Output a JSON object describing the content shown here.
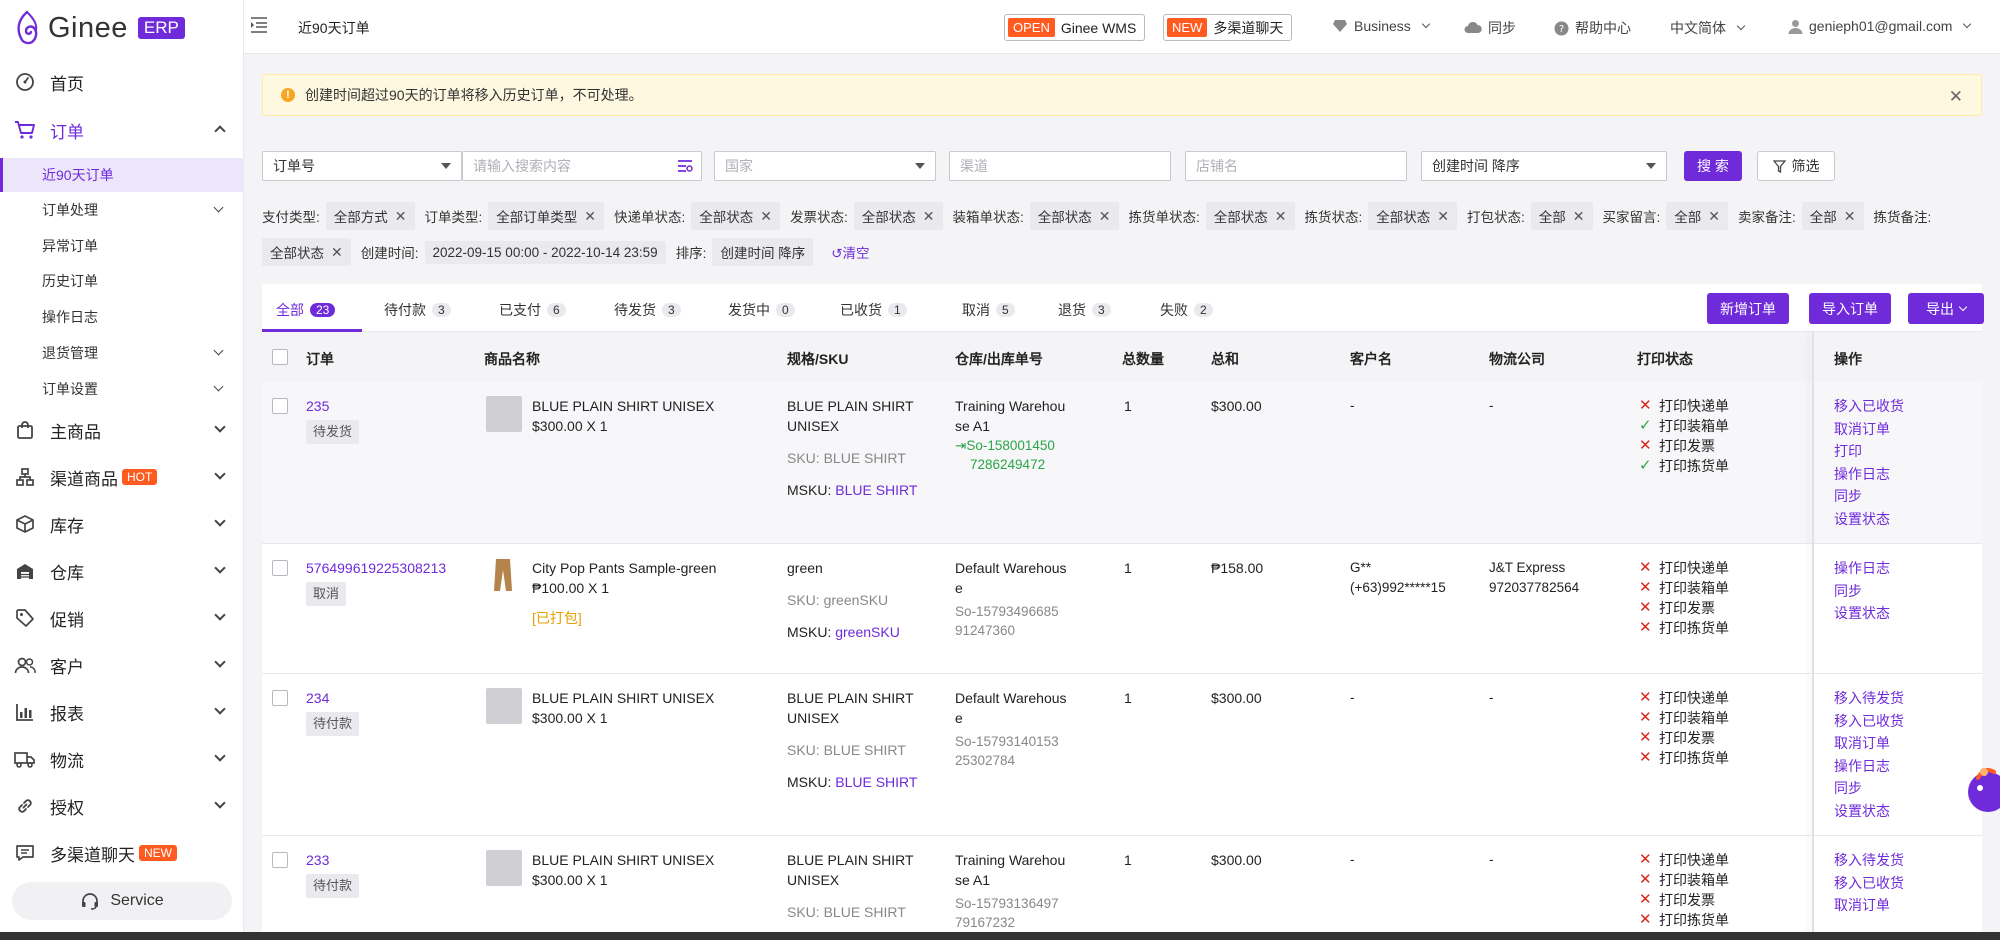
{
  "logo": {
    "name": "Ginee",
    "badge": "ERP"
  },
  "sidebar": {
    "items": [
      {
        "label": "首页",
        "icon": "dashboard-icon"
      },
      {
        "label": "订单",
        "icon": "cart-icon"
      },
      {
        "label": "主商品",
        "icon": "bag-icon"
      },
      {
        "label": "渠道商品",
        "icon": "channel-icon",
        "badge": "HOT"
      },
      {
        "label": "库存",
        "icon": "box-icon"
      },
      {
        "label": "仓库",
        "icon": "warehouse-icon"
      },
      {
        "label": "促销",
        "icon": "tag-icon"
      },
      {
        "label": "客户",
        "icon": "users-icon"
      },
      {
        "label": "报表",
        "icon": "chart-icon"
      },
      {
        "label": "物流",
        "icon": "truck-icon"
      },
      {
        "label": "授权",
        "icon": "link-icon"
      },
      {
        "label": "多渠道聊天",
        "icon": "chat-icon",
        "badge": "NEW"
      }
    ],
    "order_sub": [
      "近90天订单",
      "订单处理",
      "异常订单",
      "历史订单",
      "操作日志",
      "退货管理",
      "订单设置"
    ],
    "service": "Service"
  },
  "header": {
    "title": "近90天订单",
    "wms_tag": "OPEN",
    "wms_label": "Ginee WMS",
    "chat_tag": "NEW",
    "chat_label": "多渠道聊天",
    "business": "Business",
    "sync": "同步",
    "help": "帮助中心",
    "lang": "中文简体",
    "user": "genieph01@gmail.com"
  },
  "alert": {
    "text": "创建时间超过90天的订单将移入历史订单，不可处理。"
  },
  "filters": {
    "field": "订单号",
    "search_placeholder": "请输入搜索内容",
    "country_placeholder": "国家",
    "channel_placeholder": "渠道",
    "store_placeholder": "店铺名",
    "sort": "创建时间 降序",
    "search_btn": "搜 索",
    "filter_btn": "筛选"
  },
  "chips_row1": [
    {
      "label": "支付类型:",
      "value": "全部方式"
    },
    {
      "label": "订单类型:",
      "value": "全部订单类型"
    },
    {
      "label": "快递单状态:",
      "value": "全部状态"
    },
    {
      "label": "发票状态:",
      "value": "全部状态"
    },
    {
      "label": "装箱单状态:",
      "value": "全部状态"
    },
    {
      "label": "拣货单状态:",
      "value": "全部状态"
    },
    {
      "label": "拣货状态:",
      "value": "全部状态"
    },
    {
      "label": "打包状态:",
      "value": "全部"
    },
    {
      "label": "买家留言:",
      "value": "全部"
    },
    {
      "label": "卖家备注:",
      "value": "全部"
    }
  ],
  "chips_row1_tail": "拣货备注:",
  "chips_row2": {
    "first_value": "全部状态",
    "created_label": "创建时间:",
    "created_value": "2022-09-15 00:00 - 2022-10-14 23:59",
    "sort_label": "排序:",
    "sort_value": "创建时间 降序",
    "clear": "清空"
  },
  "tabs": [
    {
      "label": "全部",
      "count": "23"
    },
    {
      "label": "待付款",
      "count": "3"
    },
    {
      "label": "已支付",
      "count": "6"
    },
    {
      "label": "待发货",
      "count": "3"
    },
    {
      "label": "发货中",
      "count": "0"
    },
    {
      "label": "已收货",
      "count": "1"
    },
    {
      "label": "取消",
      "count": "5"
    },
    {
      "label": "退货",
      "count": "3"
    },
    {
      "label": "失败",
      "count": "2"
    }
  ],
  "actions": {
    "new_order": "新增订单",
    "import": "导入订单",
    "export": "导出"
  },
  "columns": [
    "订单",
    "商品名称",
    "规格/SKU",
    "仓库/出库单号",
    "总数量",
    "总和",
    "客户名",
    "物流公司",
    "打印状态",
    "操作"
  ],
  "print_labels": [
    "打印快递单",
    "打印装箱单",
    "打印发票",
    "打印拣货单"
  ],
  "rows": [
    {
      "order": "235",
      "status": "待发货",
      "product": "BLUE PLAIN SHIRT UNISEX",
      "price": "$300.00 X 1",
      "packed": "",
      "spec1": "BLUE PLAIN SHIRT",
      "spec2": "UNISEX",
      "sku_label": "SKU:",
      "sku": "BLUE SHIRT",
      "msku_label": "MSKU:",
      "msku": "BLUE SHIRT",
      "wh1": "Training Warehou",
      "wh2": "se A1",
      "out1": "So-158001450",
      "out2": "7286249472",
      "qty": "1",
      "total": "$300.00",
      "customer": "-",
      "customer2": "",
      "logistics": "-",
      "logistics2": "",
      "print": [
        "x",
        "ok",
        "x",
        "ok"
      ],
      "ops": [
        "移入已收货",
        "取消订单",
        "打印",
        "操作日志",
        "同步",
        "设置状态"
      ]
    },
    {
      "order": "576499619225308213",
      "status": "取消",
      "product": "City Pop Pants Sample-green",
      "price": "₱100.00 X 1",
      "packed": "[已打包]",
      "spec1": "green",
      "spec2": "",
      "sku_label": "SKU:",
      "sku": "greenSKU",
      "msku_label": "MSKU:",
      "msku": "greenSKU",
      "wh1": "Default Warehous",
      "wh2": "e",
      "out1": "So-15793496685",
      "out2": "91247360",
      "qty": "1",
      "total": "₱158.00",
      "customer": "G**",
      "customer2": "(+63)992*****15",
      "logistics": "J&T Express",
      "logistics2": "972037782564",
      "print": [
        "x",
        "x",
        "x",
        "x"
      ],
      "ops": [
        "操作日志",
        "同步",
        "设置状态"
      ]
    },
    {
      "order": "234",
      "status": "待付款",
      "product": "BLUE PLAIN SHIRT UNISEX",
      "price": "$300.00 X 1",
      "packed": "",
      "spec1": "BLUE PLAIN SHIRT",
      "spec2": "UNISEX",
      "sku_label": "SKU:",
      "sku": "BLUE SHIRT",
      "msku_label": "MSKU:",
      "msku": "BLUE SHIRT",
      "wh1": "Default Warehous",
      "wh2": "e",
      "out1": "So-15793140153",
      "out2": "25302784",
      "qty": "1",
      "total": "$300.00",
      "customer": "-",
      "customer2": "",
      "logistics": "-",
      "logistics2": "",
      "print": [
        "x",
        "x",
        "x",
        "x"
      ],
      "ops": [
        "移入待发货",
        "移入已收货",
        "取消订单",
        "操作日志",
        "同步",
        "设置状态"
      ]
    },
    {
      "order": "233",
      "status": "待付款",
      "product": "BLUE PLAIN SHIRT UNISEX",
      "price": "$300.00 X 1",
      "packed": "",
      "spec1": "BLUE PLAIN SHIRT",
      "spec2": "UNISEX",
      "sku_label": "SKU:",
      "sku": "BLUE SHIRT",
      "msku_label": "",
      "msku": "",
      "wh1": "Training Warehou",
      "wh2": "se A1",
      "out1": "So-15793136497",
      "out2": "79167232",
      "qty": "1",
      "total": "$300.00",
      "customer": "-",
      "customer2": "",
      "logistics": "-",
      "logistics2": "",
      "print": [
        "x",
        "x",
        "x",
        "x"
      ],
      "ops": [
        "移入待发货",
        "移入已收货",
        "取消订单"
      ]
    }
  ],
  "colors": {
    "accent": "#6f2bd9",
    "hot": "#ff5a1f",
    "error": "#d8281c",
    "success": "#2aa544"
  }
}
